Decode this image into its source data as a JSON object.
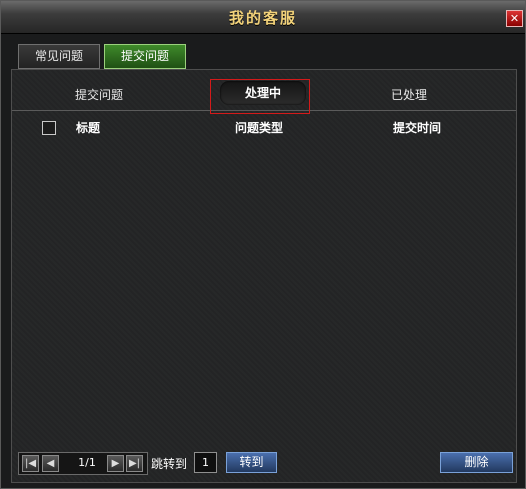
{
  "window": {
    "title": "我的客服",
    "close_glyph": "✕"
  },
  "tabs": [
    {
      "label": "常见问题",
      "active": false
    },
    {
      "label": "提交问题",
      "active": true
    }
  ],
  "subtabs": [
    {
      "label": "提交问题",
      "active": false
    },
    {
      "label": "处理中",
      "active": true
    },
    {
      "label": "已处理",
      "active": false
    }
  ],
  "table": {
    "columns": [
      "标题",
      "问题类型",
      "提交时间"
    ],
    "rows": []
  },
  "pagination": {
    "first_glyph": "|◀",
    "prev_glyph": "◀",
    "next_glyph": "▶",
    "last_glyph": "▶|",
    "page_info": "1/1",
    "jump_label": "跳转到",
    "jump_value": "1",
    "go_label": "转到"
  },
  "actions": {
    "delete_label": "删除"
  },
  "colors": {
    "title": "#f2d27a",
    "active_tab": "#3f8a2a",
    "highlight": "#d41a1a",
    "button": "#4a6fae"
  }
}
